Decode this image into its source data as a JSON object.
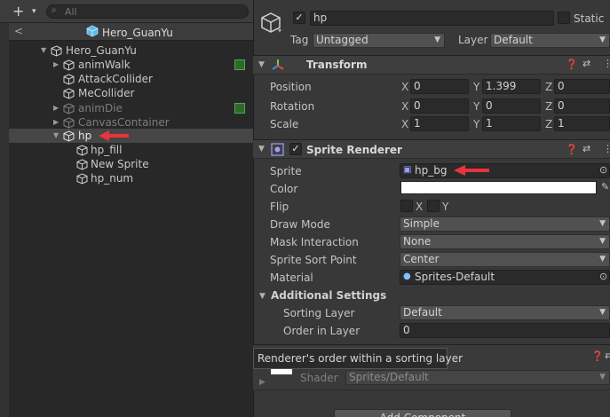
{
  "hierarchy": {
    "search_placeholder": "All",
    "prefab_title": "Hero_GuanYu",
    "items": [
      {
        "label": "Hero_GuanYu",
        "dim": false
      },
      {
        "label": "animWalk",
        "dim": false
      },
      {
        "label": "AttackCollider",
        "dim": false
      },
      {
        "label": "MeCollider",
        "dim": false
      },
      {
        "label": "animDie",
        "dim": true
      },
      {
        "label": "CanvasContainer",
        "dim": true
      },
      {
        "label": "hp",
        "dim": false
      },
      {
        "label": "hp_fill",
        "dim": false
      },
      {
        "label": "New Sprite",
        "dim": false
      },
      {
        "label": "hp_num",
        "dim": false
      }
    ]
  },
  "inspector": {
    "object_name": "hp",
    "static_label": "Static",
    "tag_label": "Tag",
    "tag_value": "Untagged",
    "layer_label": "Layer",
    "layer_value": "Default",
    "transform": {
      "title": "Transform",
      "position_label": "Position",
      "rotation_label": "Rotation",
      "scale_label": "Scale",
      "position": {
        "x": "0",
        "y": "1.399",
        "z": "0"
      },
      "rotation": {
        "x": "0",
        "y": "0",
        "z": "0"
      },
      "scale": {
        "x": "1",
        "y": "1",
        "z": "1"
      }
    },
    "sprite_renderer": {
      "title": "Sprite Renderer",
      "sprite_label": "Sprite",
      "sprite_value": "hp_bg",
      "color_label": "Color",
      "color_value": "#ffffff",
      "flip_label": "Flip",
      "flip_x": "X",
      "flip_y": "Y",
      "draw_mode_label": "Draw Mode",
      "draw_mode_value": "Simple",
      "mask_label": "Mask Interaction",
      "mask_value": "None",
      "sort_point_label": "Sprite Sort Point",
      "sort_point_value": "Center",
      "material_label": "Material",
      "material_value": "Sprites-Default",
      "additional_label": "Additional Settings",
      "sorting_layer_label": "Sorting Layer",
      "sorting_layer_value": "Default",
      "order_label": "Order in Layer",
      "order_value": "0"
    },
    "tooltip": "Renderer's order within a sorting layer",
    "material_section": {
      "shader_label": "Shader",
      "shader_value": "Sprites/Default"
    },
    "add_component": "Add Component"
  },
  "axes": {
    "x": "X",
    "y": "Y",
    "z": "Z"
  },
  "colors": {
    "accent_arrow": "#e8343a",
    "selected_row": "#464646"
  }
}
